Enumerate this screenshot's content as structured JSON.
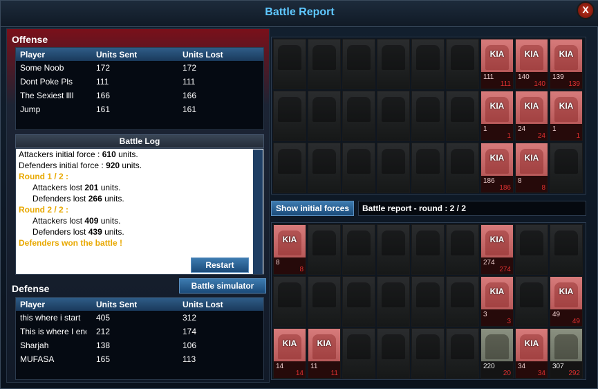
{
  "window": {
    "title": "Battle Report",
    "close_label": "X"
  },
  "offense": {
    "heading": "Offense",
    "columns": [
      "Player",
      "Units Sent",
      "Units Lost"
    ],
    "rows": [
      [
        "Some Noob",
        "172",
        "172"
      ],
      [
        "Dont Poke Pls",
        "111",
        "111"
      ],
      [
        "The Sexiest llll",
        "166",
        "166"
      ],
      [
        "Jump",
        "161",
        "161"
      ]
    ]
  },
  "battle_log": {
    "heading": "Battle Log",
    "lines": [
      {
        "text": "Attackers initial force : ",
        "bold": "610",
        "suffix": " units.",
        "style": "normal"
      },
      {
        "text": "Defenders initial force : ",
        "bold": "920",
        "suffix": " units.",
        "style": "normal"
      },
      {
        "text": "Round 1 / 2",
        "bold": "",
        "suffix": " :",
        "style": "round"
      },
      {
        "text": "Attackers lost ",
        "bold": "201",
        "suffix": " units.",
        "style": "indent"
      },
      {
        "text": "Defenders lost ",
        "bold": "266",
        "suffix": " units.",
        "style": "indent"
      },
      {
        "text": "Round 2 / 2",
        "bold": "",
        "suffix": " :",
        "style": "round"
      },
      {
        "text": "Attackers lost ",
        "bold": "409",
        "suffix": " units.",
        "style": "indent"
      },
      {
        "text": "Defenders lost ",
        "bold": "439",
        "suffix": " units.",
        "style": "indent"
      },
      {
        "text": "Defenders won the battle !",
        "bold": "",
        "suffix": "",
        "style": "result"
      }
    ],
    "restart_label": "Restart"
  },
  "simulator_label": "Battle simulator",
  "defense": {
    "heading": "Defense",
    "columns": [
      "Player",
      "Units Sent",
      "Units Lost"
    ],
    "rows": [
      [
        "this where i start",
        "405",
        "312"
      ],
      [
        "This is where I end",
        "212",
        "174"
      ],
      [
        "Sharjah",
        "138",
        "106"
      ],
      [
        "MUFASA",
        "165",
        "113"
      ]
    ]
  },
  "show_initial_label": "Show initial forces",
  "round_label": "Battle report - round : 2 / 2",
  "kia_text": "KIA",
  "attacker_grid": [
    [
      {
        "s": "dark"
      },
      {
        "s": "dark"
      },
      {
        "s": "dark"
      },
      {
        "s": "dark"
      },
      {
        "s": "dark"
      },
      {
        "s": "dark"
      },
      {
        "s": "kia",
        "sent": "111",
        "lost": "111"
      },
      {
        "s": "kia",
        "sent": "140",
        "lost": "140"
      },
      {
        "s": "kia",
        "sent": "139",
        "lost": "139"
      }
    ],
    [
      {
        "s": "dark"
      },
      {
        "s": "dark"
      },
      {
        "s": "dark"
      },
      {
        "s": "dark"
      },
      {
        "s": "dark"
      },
      {
        "s": "dark"
      },
      {
        "s": "kia",
        "sent": "1",
        "lost": "1"
      },
      {
        "s": "kia",
        "sent": "24",
        "lost": "24"
      },
      {
        "s": "kia",
        "sent": "1",
        "lost": "1"
      }
    ],
    [
      {
        "s": "dark"
      },
      {
        "s": "dark"
      },
      {
        "s": "dark"
      },
      {
        "s": "dark"
      },
      {
        "s": "dark"
      },
      {
        "s": "dark"
      },
      {
        "s": "kia",
        "sent": "186",
        "lost": "186"
      },
      {
        "s": "kia",
        "sent": "8",
        "lost": "8"
      },
      {
        "s": "dark"
      }
    ]
  ],
  "defender_grid": [
    [
      {
        "s": "kia",
        "sent": "8",
        "lost": "8"
      },
      {
        "s": "dark"
      },
      {
        "s": "dark"
      },
      {
        "s": "dark"
      },
      {
        "s": "dark"
      },
      {
        "s": "dark"
      },
      {
        "s": "kia",
        "sent": "274",
        "lost": "274"
      },
      {
        "s": "dark"
      },
      {
        "s": "dark"
      }
    ],
    [
      {
        "s": "dark"
      },
      {
        "s": "dark"
      },
      {
        "s": "dark"
      },
      {
        "s": "dark"
      },
      {
        "s": "dark"
      },
      {
        "s": "dark"
      },
      {
        "s": "kia",
        "sent": "3",
        "lost": "3"
      },
      {
        "s": "dark"
      },
      {
        "s": "kia",
        "sent": "49",
        "lost": "49"
      }
    ],
    [
      {
        "s": "kia",
        "sent": "14",
        "lost": "14"
      },
      {
        "s": "kia",
        "sent": "11",
        "lost": "11"
      },
      {
        "s": "dark"
      },
      {
        "s": "dark"
      },
      {
        "s": "dark"
      },
      {
        "s": "dark"
      },
      {
        "s": "alive",
        "sent": "220",
        "lost": "20"
      },
      {
        "s": "kia",
        "sent": "34",
        "lost": "34"
      },
      {
        "s": "alive",
        "sent": "307",
        "lost": "292"
      }
    ]
  ]
}
